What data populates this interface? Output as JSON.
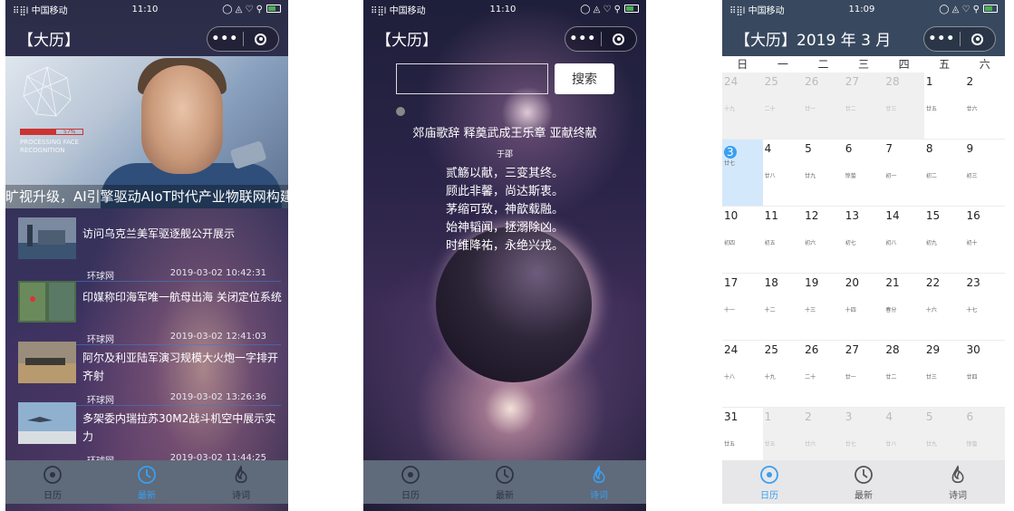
{
  "status": {
    "carrier": "中国移动",
    "signal": "⠿⣿l",
    "time_p1": "11:10",
    "time_p2": "11:10",
    "time_p3": "11:09",
    "icons": "◯ ◬ ♡ ⚲"
  },
  "capsule": {
    "more": "•••"
  },
  "p1": {
    "title": "【大历】",
    "banner_caption": "旷视升级，AI引擎驱动AIoT时代产业物联网构建",
    "processing": {
      "label": "PROCESSING FACE RECOGNITION",
      "percent": "57%",
      "fraction": 0.57
    },
    "news": [
      {
        "title": "访问乌克兰美军驱逐舰公开展示",
        "source": "环球网",
        "time": "2019-03-02 10:42:31"
      },
      {
        "title": "印媒称印海军唯一航母出海 关闭定位系统",
        "source": "环球网",
        "time": "2019-03-02 12:41:03"
      },
      {
        "title": "阿尔及利亚陆军演习规模大火炮一字排开齐射",
        "source": "环球网",
        "time": "2019-03-02 13:26:36"
      },
      {
        "title": "多架委内瑞拉苏30M2战斗机空中展示实力",
        "source": "环球网",
        "time": "2019-03-02 11:44:25"
      }
    ]
  },
  "p2": {
    "title": "【大历】",
    "search_button": "搜索",
    "search_placeholder": "",
    "poem_title": "郊庙歌辞 释奠武成王乐章 亚献终献",
    "poem_author": "于邵",
    "poem_lines": [
      "贰觞以献，三变其终。",
      "顾此非馨，尚达斯衷。",
      "茅缩可致，神歆载融。",
      "始神韬闻，拯溺除凶。",
      "时维降祐，永绝兴戎。"
    ]
  },
  "p3": {
    "title": "【大历】2019 年 3 月",
    "weekdays": [
      "日",
      "一",
      "二",
      "三",
      "四",
      "五",
      "六"
    ],
    "weeks": [
      [
        {
          "n": "24",
          "l": "十九",
          "m": true
        },
        {
          "n": "25",
          "l": "二十",
          "m": true
        },
        {
          "n": "26",
          "l": "廿一",
          "m": true
        },
        {
          "n": "27",
          "l": "廿二",
          "m": true
        },
        {
          "n": "28",
          "l": "廿三",
          "m": true
        },
        {
          "n": "1",
          "l": "廿五"
        },
        {
          "n": "2",
          "l": "廿六"
        }
      ],
      [
        {
          "n": "3",
          "l": "廿七",
          "t": true
        },
        {
          "n": "4",
          "l": "廿八"
        },
        {
          "n": "5",
          "l": "廿九"
        },
        {
          "n": "6",
          "l": "惊蛰"
        },
        {
          "n": "7",
          "l": "初一"
        },
        {
          "n": "8",
          "l": "初二"
        },
        {
          "n": "9",
          "l": "初三"
        }
      ],
      [
        {
          "n": "10",
          "l": "初四"
        },
        {
          "n": "11",
          "l": "初五"
        },
        {
          "n": "12",
          "l": "初六"
        },
        {
          "n": "13",
          "l": "初七"
        },
        {
          "n": "14",
          "l": "初八"
        },
        {
          "n": "15",
          "l": "初九"
        },
        {
          "n": "16",
          "l": "初十"
        }
      ],
      [
        {
          "n": "17",
          "l": "十一"
        },
        {
          "n": "18",
          "l": "十二"
        },
        {
          "n": "19",
          "l": "十三"
        },
        {
          "n": "20",
          "l": "十四"
        },
        {
          "n": "21",
          "l": "春分"
        },
        {
          "n": "22",
          "l": "十六"
        },
        {
          "n": "23",
          "l": "十七"
        }
      ],
      [
        {
          "n": "24",
          "l": "十八"
        },
        {
          "n": "25",
          "l": "十九"
        },
        {
          "n": "26",
          "l": "二十"
        },
        {
          "n": "27",
          "l": "廿一"
        },
        {
          "n": "28",
          "l": "廿二"
        },
        {
          "n": "29",
          "l": "廿三"
        },
        {
          "n": "30",
          "l": "廿四"
        }
      ],
      [
        {
          "n": "31",
          "l": "廿五"
        },
        {
          "n": "1",
          "l": "廿五",
          "m": true
        },
        {
          "n": "2",
          "l": "廿六",
          "m": true
        },
        {
          "n": "3",
          "l": "廿七",
          "m": true
        },
        {
          "n": "4",
          "l": "廿八",
          "m": true
        },
        {
          "n": "5",
          "l": "廿九",
          "m": true
        },
        {
          "n": "6",
          "l": "惊蛰",
          "m": true
        }
      ]
    ]
  },
  "tabs": [
    {
      "label": "日历",
      "icon": "calendar-icon"
    },
    {
      "label": "最新",
      "icon": "clock-icon"
    },
    {
      "label": "诗词",
      "icon": "flame-icon"
    }
  ],
  "colors": {
    "active_tab": "#3a9ff0",
    "calendar_header": "#38485f",
    "tabbar_dark": "#5f6a7a"
  }
}
